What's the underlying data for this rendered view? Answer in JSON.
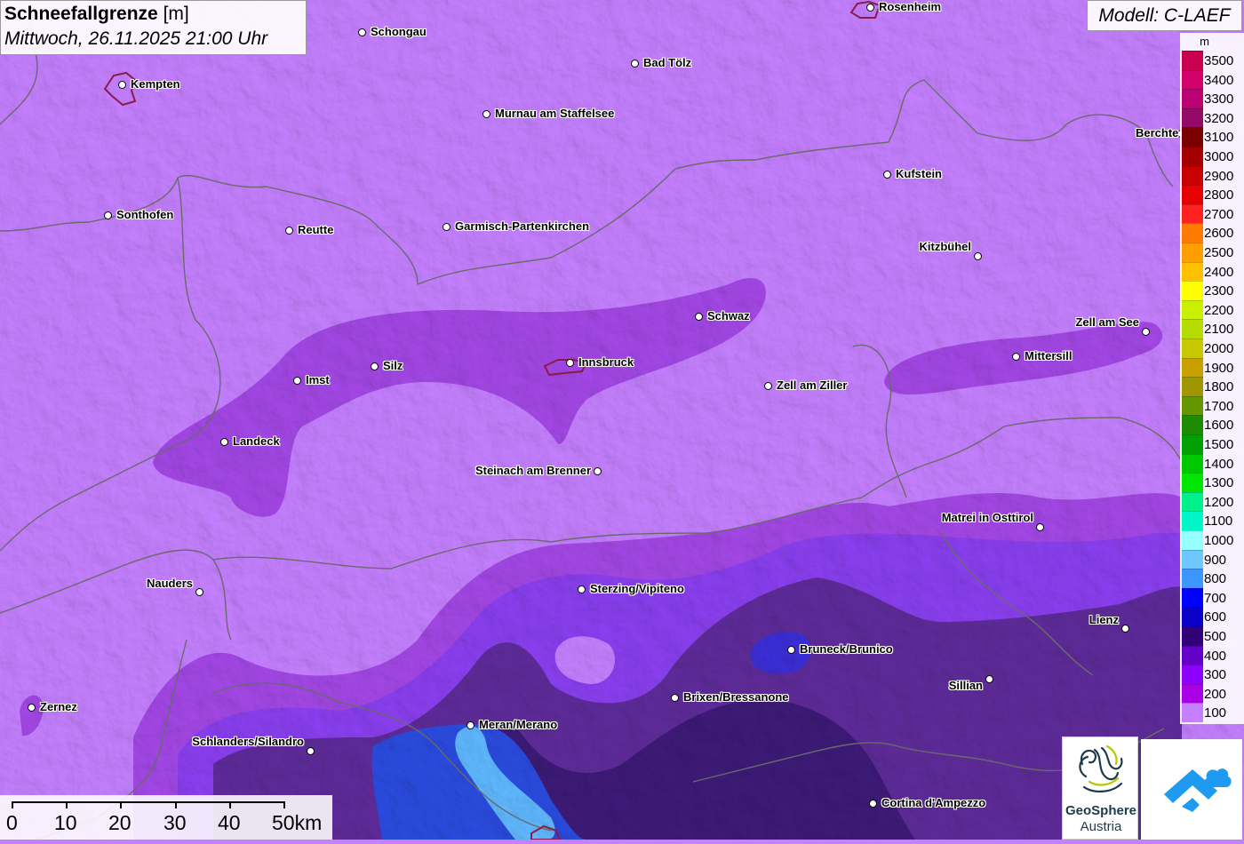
{
  "header": {
    "title_bold": "Schneefallgrenze",
    "title_unit": "[m]",
    "datetime": "Mittwoch, 26.11.2025 21:00 Uhr"
  },
  "model": {
    "label": "Modell: C-LAEF"
  },
  "legend": {
    "unit": "m",
    "items": [
      {
        "label": "3500",
        "color": "#c8004f"
      },
      {
        "label": "3400",
        "color": "#d2006b"
      },
      {
        "label": "3300",
        "color": "#bb0073"
      },
      {
        "label": "3200",
        "color": "#960a67"
      },
      {
        "label": "3100",
        "color": "#7a0000"
      },
      {
        "label": "3000",
        "color": "#a50000"
      },
      {
        "label": "2900",
        "color": "#c80000"
      },
      {
        "label": "2800",
        "color": "#e60000"
      },
      {
        "label": "2700",
        "color": "#ff2020"
      },
      {
        "label": "2600",
        "color": "#ff7a00"
      },
      {
        "label": "2500",
        "color": "#ff9e00"
      },
      {
        "label": "2400",
        "color": "#ffc000"
      },
      {
        "label": "2300",
        "color": "#ffff00"
      },
      {
        "label": "2200",
        "color": "#c8f000"
      },
      {
        "label": "2100",
        "color": "#b4dc00"
      },
      {
        "label": "2000",
        "color": "#c8c800"
      },
      {
        "label": "1900",
        "color": "#c8a000"
      },
      {
        "label": "1800",
        "color": "#a09600"
      },
      {
        "label": "1700",
        "color": "#649600"
      },
      {
        "label": "1600",
        "color": "#1e8c00"
      },
      {
        "label": "1500",
        "color": "#00a000"
      },
      {
        "label": "1400",
        "color": "#00c800"
      },
      {
        "label": "1300",
        "color": "#00e600"
      },
      {
        "label": "1200",
        "color": "#00f08c"
      },
      {
        "label": "1100",
        "color": "#00f5c8"
      },
      {
        "label": "1000",
        "color": "#96ffff"
      },
      {
        "label": "900",
        "color": "#6ec8ff"
      },
      {
        "label": "800",
        "color": "#3c96ff"
      },
      {
        "label": "700",
        "color": "#0000ff"
      },
      {
        "label": "600",
        "color": "#0a00c8"
      },
      {
        "label": "500",
        "color": "#320078"
      },
      {
        "label": "400",
        "color": "#6400c8"
      },
      {
        "label": "300",
        "color": "#8c00ff"
      },
      {
        "label": "200",
        "color": "#aa00e6"
      },
      {
        "label": "100",
        "color": "#c580ff"
      }
    ]
  },
  "cities": [
    {
      "name": "Rosenheim",
      "align": "right"
    },
    {
      "name": "Schongau",
      "align": "right"
    },
    {
      "name": "Kempten",
      "align": "right"
    },
    {
      "name": "Bad Tölz",
      "align": "right"
    },
    {
      "name": "Murnau am Staffelsee",
      "align": "right"
    },
    {
      "name": "Berchte",
      "align": "left"
    },
    {
      "name": "Kufstein",
      "align": "right"
    },
    {
      "name": "Sonthofen",
      "align": "right"
    },
    {
      "name": "Reutte",
      "align": "right"
    },
    {
      "name": "Garmisch-Partenkirchen",
      "align": "right"
    },
    {
      "name": "Kitzbühel",
      "align": "left"
    },
    {
      "name": "Schwaz",
      "align": "right"
    },
    {
      "name": "Zell am See",
      "align": "left"
    },
    {
      "name": "Mittersill",
      "align": "right"
    },
    {
      "name": "Silz",
      "align": "right"
    },
    {
      "name": "Innsbruck",
      "align": "right"
    },
    {
      "name": "Imst",
      "align": "right"
    },
    {
      "name": "Zell am Ziller",
      "align": "right"
    },
    {
      "name": "Landeck",
      "align": "right"
    },
    {
      "name": "Steinach am Brenner",
      "align": "left"
    },
    {
      "name": "Matrei in Osttirol",
      "align": "left"
    },
    {
      "name": "Nauders",
      "align": "left"
    },
    {
      "name": "Sterzing/Vipiteno",
      "align": "right"
    },
    {
      "name": "Lienz",
      "align": "left"
    },
    {
      "name": "Bruneck/Brunico",
      "align": "right"
    },
    {
      "name": "Sillian",
      "align": "left"
    },
    {
      "name": "Brixen/Bressanone",
      "align": "right"
    },
    {
      "name": "Zernez",
      "align": "right"
    },
    {
      "name": "Meran/Merano",
      "align": "right"
    },
    {
      "name": "Schlanders/Silandro",
      "align": "left"
    },
    {
      "name": "Cortina d'Ampezzo",
      "align": "right"
    }
  ],
  "scale": {
    "labels": [
      "0",
      "10",
      "20",
      "30",
      "40",
      "50km"
    ]
  },
  "logos": {
    "geosphere_line1": "GeoSphere",
    "geosphere_line2": "Austria"
  }
}
